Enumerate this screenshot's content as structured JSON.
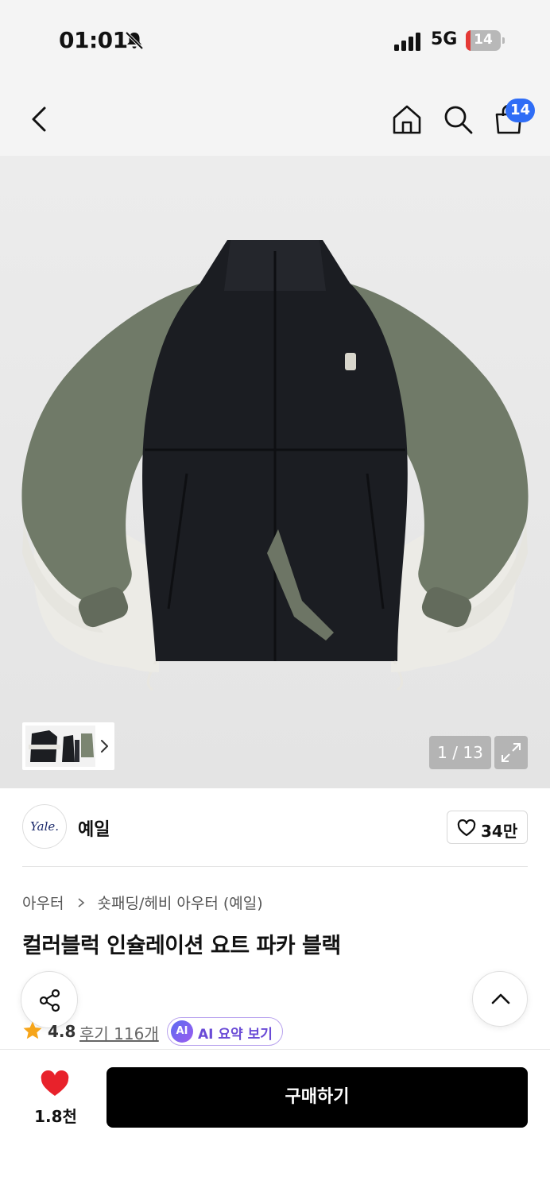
{
  "status_bar": {
    "time": "01:01",
    "network": "5G",
    "battery_level": "14",
    "battery_fraction": 0.14,
    "battery_color": "#e53935"
  },
  "nav": {
    "back_icon": "chevron-left-icon",
    "home_icon": "home-icon",
    "search_icon": "search-icon",
    "cart_icon": "shopping-bag-icon",
    "cart_badge": "14",
    "badge_color": "#2f6df6"
  },
  "gallery": {
    "page_counter": "1 / 13",
    "expand_icon": "expand-icon"
  },
  "brand": {
    "logo_text": "Yale.",
    "name": "예일",
    "like_count": "34만"
  },
  "product": {
    "breadcrumb": [
      "아우터",
      "숏패딩/헤비 아우터 (예일)"
    ],
    "title": "컬러블럭 인슐레이션 요트 파카 블랙",
    "rating": "4.8",
    "reviews": "후기 116개",
    "ai_badge": "AI",
    "ai_label": "AI 요약 보기"
  },
  "bottom_bar": {
    "wish_count": "1.8천",
    "buy_label": "구매하기",
    "heart_color": "#e8222b"
  }
}
